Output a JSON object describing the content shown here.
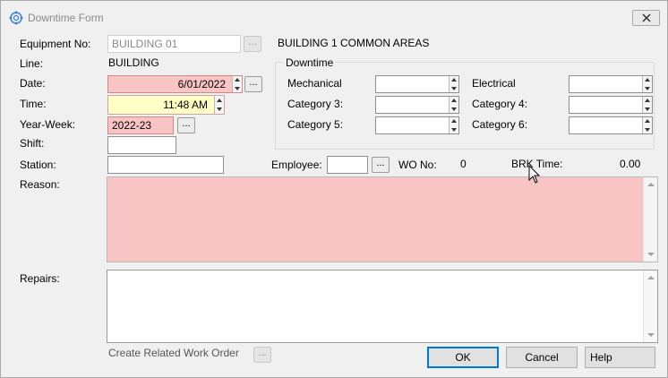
{
  "window": {
    "title": "Downtime Form"
  },
  "equipment": {
    "label": "Equipment No:",
    "value": "BUILDING 01",
    "description": "BUILDING 1 COMMON AREAS"
  },
  "line": {
    "label": "Line:",
    "value": "BUILDING"
  },
  "date": {
    "label": "Date:",
    "value": "6/01/2022"
  },
  "time": {
    "label": "Time:",
    "value": "11:48 AM"
  },
  "year_week": {
    "label": "Year-Week:",
    "value": "2022-23"
  },
  "shift": {
    "label": "Shift:",
    "value": ""
  },
  "station": {
    "label": "Station:",
    "value": ""
  },
  "employee": {
    "label": "Employee:",
    "value": ""
  },
  "wo": {
    "label": "WO No:",
    "value": "0"
  },
  "brk": {
    "label": "BRK Time:",
    "value": "0.00"
  },
  "downtime": {
    "title": "Downtime",
    "mechanical": {
      "label": "Mechanical",
      "value": ""
    },
    "electrical": {
      "label": "Electrical",
      "value": ""
    },
    "category3": {
      "label": "Category 3:",
      "value": ""
    },
    "category4": {
      "label": "Category 4:",
      "value": ""
    },
    "category5": {
      "label": "Category 5:",
      "value": ""
    },
    "category6": {
      "label": "Category 6:",
      "value": ""
    }
  },
  "reason": {
    "label": "Reason:",
    "value": ""
  },
  "repairs": {
    "label": "Repairs:",
    "value": ""
  },
  "related_work_order": {
    "label": "Create Related Work Order"
  },
  "buttons": {
    "ok": "OK",
    "cancel": "Cancel",
    "help": "Help",
    "ellipsis": "..."
  },
  "colors": {
    "required": "#f9c4c4",
    "focused": "#ffffc6",
    "default_button_border": "#0078d7"
  }
}
